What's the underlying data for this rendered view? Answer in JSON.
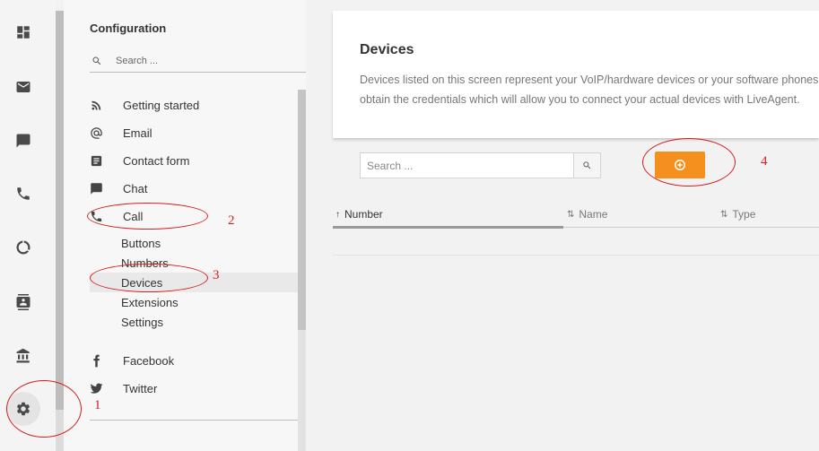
{
  "rail": {
    "items": [
      {
        "icon": "dashboard-icon"
      },
      {
        "icon": "email-icon"
      },
      {
        "icon": "chat-icon"
      },
      {
        "icon": "phone-icon"
      },
      {
        "icon": "reports-icon"
      },
      {
        "icon": "contacts-icon"
      },
      {
        "icon": "knowledgebase-icon"
      },
      {
        "icon": "settings-icon",
        "active": true
      }
    ]
  },
  "nav": {
    "title": "Configuration",
    "search_placeholder": "Search ...",
    "items": [
      {
        "label": "Getting started",
        "icon": "rss-icon"
      },
      {
        "label": "Email",
        "icon": "at-icon"
      },
      {
        "label": "Contact form",
        "icon": "form-icon"
      },
      {
        "label": "Chat",
        "icon": "chat-icon"
      },
      {
        "label": "Call",
        "icon": "phone-icon"
      }
    ],
    "call_subitems": [
      {
        "label": "Buttons"
      },
      {
        "label": "Numbers"
      },
      {
        "label": "Devices",
        "active": true
      },
      {
        "label": "Extensions"
      },
      {
        "label": "Settings"
      }
    ],
    "social_items": [
      {
        "label": "Facebook",
        "icon": "facebook-icon"
      },
      {
        "label": "Twitter",
        "icon": "twitter-icon"
      }
    ]
  },
  "main": {
    "title": "Devices",
    "description_line1": "Devices listed on this screen represent your VoIP/hardware devices or your software phones.",
    "description_line2": "obtain the credentials which will allow you to connect your actual devices with LiveAgent.",
    "search_placeholder": "Search ...",
    "add_button_icon": "plus-circle-icon",
    "columns": [
      {
        "label": "Number",
        "sort_icon": "↑"
      },
      {
        "label": "Name",
        "sort_icon": "⇅"
      },
      {
        "label": "Type",
        "sort_icon": "⇅"
      }
    ]
  },
  "annotations": {
    "labels": [
      "1",
      "2",
      "3",
      "4"
    ],
    "color": "#d32020"
  },
  "colors": {
    "accent": "#f5901e"
  }
}
